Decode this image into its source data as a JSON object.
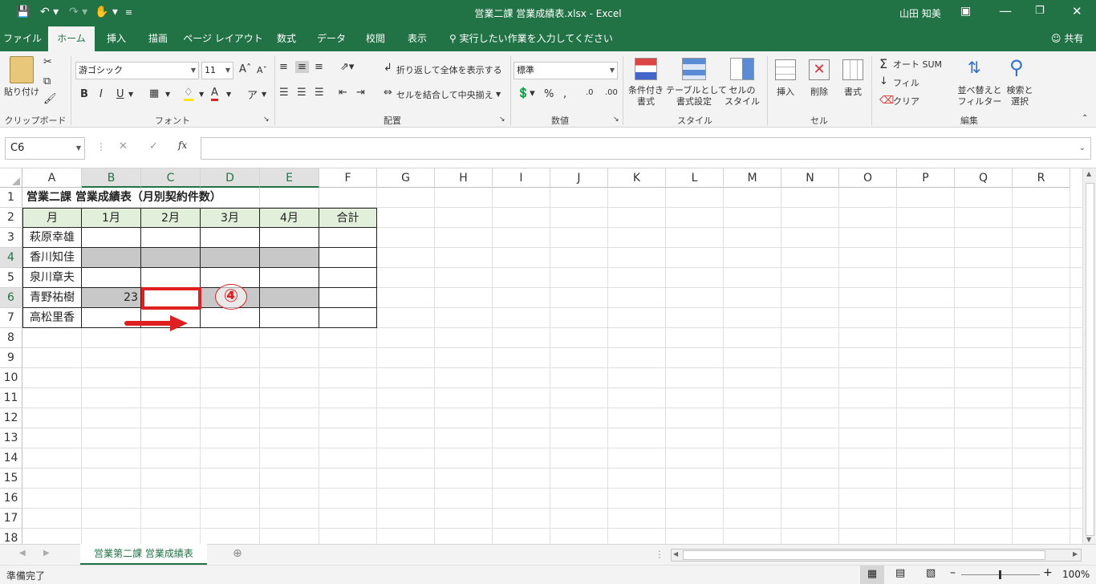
{
  "window": {
    "title": "営業二課 営業成績表.xlsx  -  Excel",
    "user": "山田 知美",
    "share": "共有"
  },
  "tabs": [
    "ファイル",
    "ホーム",
    "挿入",
    "描画",
    "ページ レイアウト",
    "数式",
    "データ",
    "校閲",
    "表示"
  ],
  "tell_me": "実行したい作業を入力してください",
  "ribbon": {
    "clipboard": {
      "paste": "貼り付け",
      "group": "クリップボード"
    },
    "font": {
      "name": "游ゴシック",
      "size": "11",
      "bold": "B",
      "italic": "I",
      "underline": "U",
      "group": "フォント"
    },
    "alignment": {
      "wrap": "折り返して全体を表示する",
      "merge": "セルを結合して中央揃え",
      "group": "配置"
    },
    "number": {
      "format": "標準",
      "group": "数値"
    },
    "styles": {
      "cond": "条件付き\n書式",
      "table": "テーブルとして\n書式設定",
      "cellstyle": "セルの\nスタイル",
      "group": "スタイル"
    },
    "cells": {
      "insert": "挿入",
      "delete": "削除",
      "format": "書式",
      "group": "セル"
    },
    "editing": {
      "autosum": "オート SUM",
      "fill": "フィル",
      "clear": "クリア",
      "sort": "並べ替えと\nフィルター",
      "find": "検索と\n選択",
      "group": "編集"
    }
  },
  "formula_bar": {
    "name_box": "C6",
    "fx": "fx",
    "value": ""
  },
  "columns": [
    "A",
    "B",
    "C",
    "D",
    "E",
    "F",
    "G",
    "H",
    "I",
    "J",
    "K",
    "L",
    "M",
    "N",
    "O",
    "P",
    "Q",
    "R"
  ],
  "rows": [
    "1",
    "2",
    "3",
    "4",
    "5",
    "6",
    "7",
    "8",
    "9",
    "10",
    "11",
    "12",
    "13",
    "14",
    "15",
    "16",
    "17",
    "18"
  ],
  "table": {
    "title": "営業二課 営業成績表（月別契約件数）",
    "headers": [
      "月",
      "1月",
      "2月",
      "3月",
      "4月",
      "合計"
    ],
    "names": [
      "萩原幸雄",
      "香川知佳",
      "泉川章夫",
      "青野祐樹",
      "高松里香"
    ],
    "b6": "23"
  },
  "annotation": {
    "step": "④",
    "accent": "#e02020"
  },
  "sheet_tab": "営業第二課 営業成績表",
  "status": {
    "ready": "準備完了",
    "zoom": "100%"
  }
}
